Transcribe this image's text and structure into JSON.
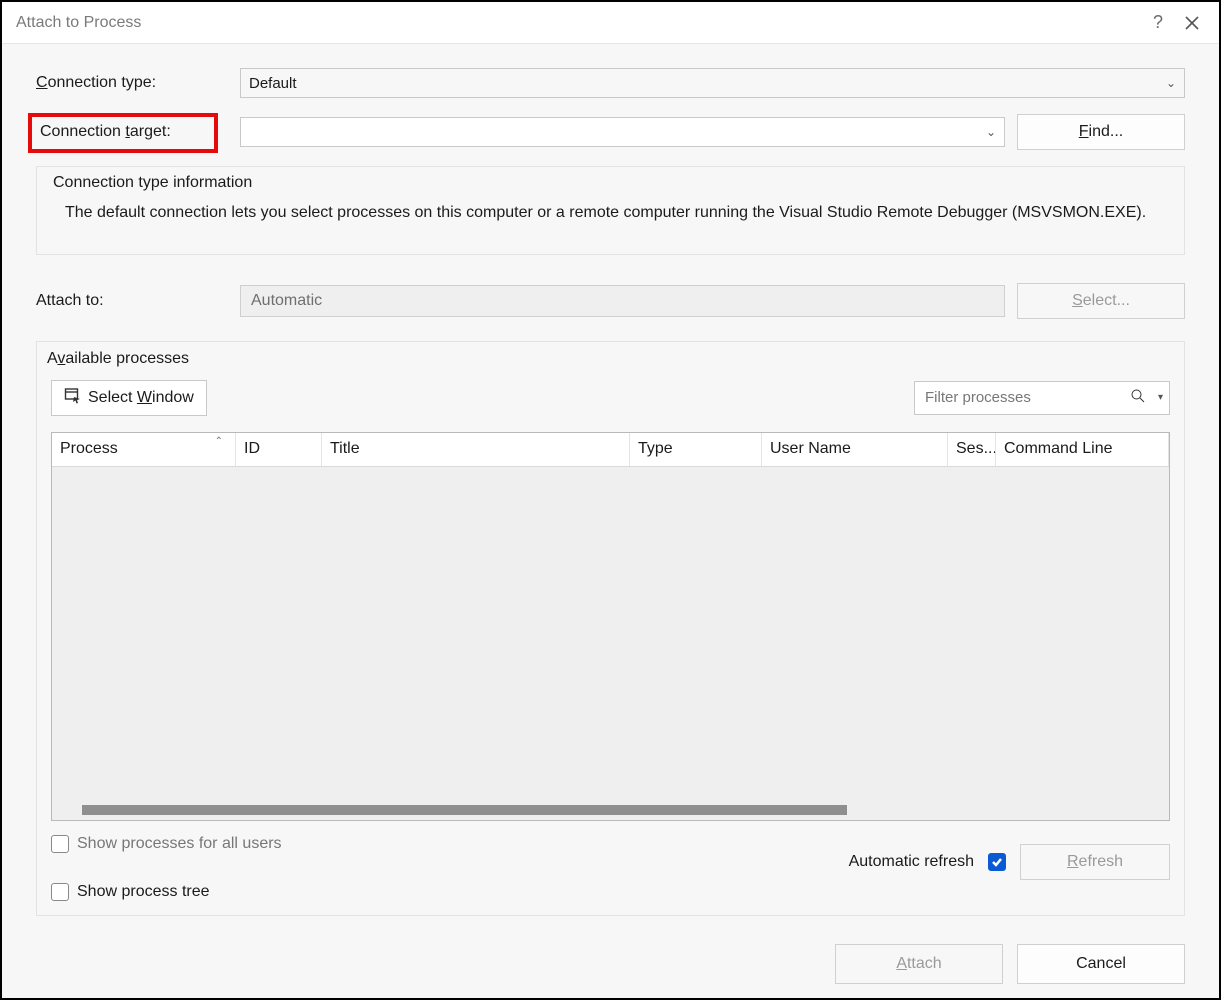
{
  "window": {
    "title": "Attach to Process"
  },
  "labels": {
    "connection_type_prefix": "C",
    "connection_type_rest": "onnection type:",
    "connection_target_prefix": "Connection ",
    "connection_target_ul": "t",
    "connection_target_rest": "arget:",
    "attach_to": "Attach to:",
    "available_prefix": "A",
    "available_ul": "v",
    "available_rest": "ailable processes"
  },
  "connection_type": {
    "value": "Default"
  },
  "connection_target": {
    "value": ""
  },
  "find_button": {
    "prefix": "F",
    "rest": "ind...",
    "ul": "F"
  },
  "info_group": {
    "legend": "Connection type information",
    "desc": "The default connection lets you select processes on this computer or a remote computer running the Visual Studio Remote Debugger (MSVSMON.EXE)."
  },
  "attach_to": {
    "value": "Automatic"
  },
  "select_button": {
    "ul": "S",
    "rest": "elect..."
  },
  "select_window_button": {
    "prefix": "Select ",
    "ul": "W",
    "rest": "indow"
  },
  "filter": {
    "placeholder": "Filter processes"
  },
  "columns": {
    "process": "Process",
    "id": "ID",
    "title": "Title",
    "type": "Type",
    "user": "User Name",
    "session": "Ses...",
    "cmd": "Command Line"
  },
  "checkboxes": {
    "show_all_users_prefix": "Show processes for all ",
    "show_all_users_ul": "u",
    "show_all_users_rest": "sers",
    "show_tree_prefix": "Show process tr",
    "show_tree_ul": "e",
    "show_tree_rest": "e"
  },
  "auto_refresh": {
    "label": "Automatic refresh",
    "checked": true
  },
  "refresh_button": {
    "ul": "R",
    "rest": "efresh"
  },
  "footer": {
    "attach": {
      "ul": "A",
      "rest": "ttach"
    },
    "cancel": "Cancel"
  }
}
